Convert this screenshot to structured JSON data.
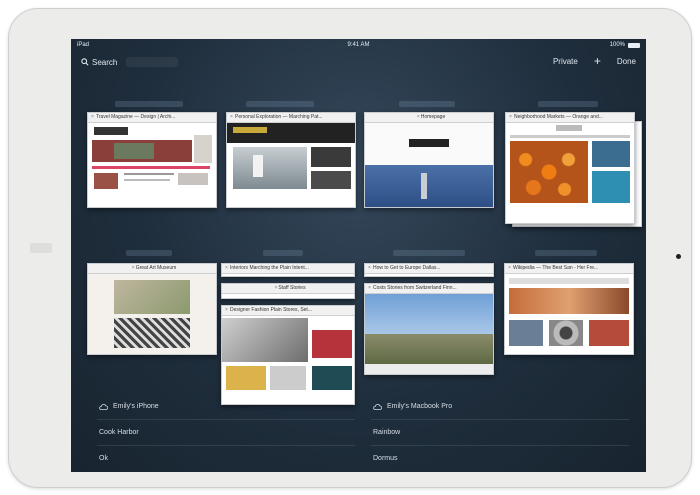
{
  "status": {
    "carrier": "iPad",
    "time": "9:41 AM",
    "battery": "100%"
  },
  "toolbar": {
    "search_label": "Search",
    "private_label": "Private",
    "add_label": "+",
    "done_label": "Done"
  },
  "tabs": [
    {
      "title": "Travel Magazine — Design | Archi..."
    },
    {
      "title": "Personal Exploration — Marching Pat..."
    },
    {
      "title": "Homepage"
    },
    {
      "title": "Neighborhood Markets — Orange and..."
    },
    {
      "title": "Great Art Museum"
    },
    {
      "title": "Interiors Marching the Plain Intent..."
    },
    {
      "title": "Staff Stories"
    },
    {
      "title": "Designer Fashion Plain Stores, Set..."
    },
    {
      "title": "How to Get to Europe Dallas..."
    },
    {
      "title": "Costs Stories from Switzerland Finn..."
    },
    {
      "title": "Wikipedia — The Best San - Her Fre..."
    }
  ],
  "cloud": {
    "left": {
      "device": "Emily's iPhone",
      "items": [
        "Cook Harbor",
        "Ok"
      ]
    },
    "right": {
      "device": "Emily's Macbook Pro",
      "items": [
        "Rainbow",
        "Dormus"
      ]
    }
  }
}
